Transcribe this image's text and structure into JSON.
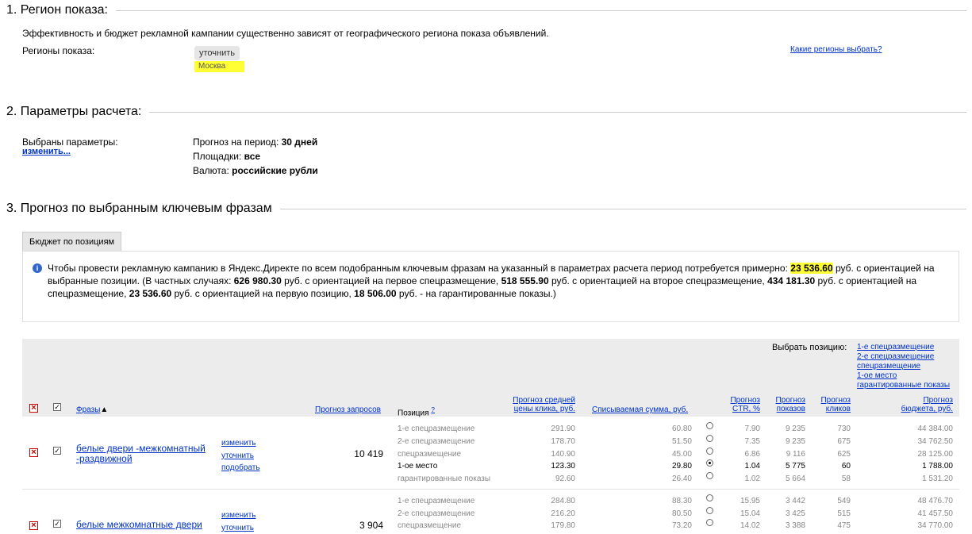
{
  "sections": {
    "s1": "1. Регион показа:",
    "s2": "2. Параметры расчета:",
    "s3": "3. Прогноз по выбранным ключевым фразам"
  },
  "region": {
    "desc": "Эффективность и бюджет рекламной кампании существенно зависят от географического региона показа объявлений.",
    "label": "Регионы показа:",
    "refine_button": "уточнить",
    "selected_region": "Москва",
    "help_link": "Какие регионы выбрать?"
  },
  "params": {
    "label": "Выбраны параметры:",
    "change_link": "изменить...",
    "period_label": "Прогноз на период:",
    "period_value": "30 дней",
    "sites_label": "Площадки:",
    "sites_value": "все",
    "currency_label": "Валюта:",
    "currency_value": "российские рубли"
  },
  "tab_label": "Бюджет по позициям",
  "info": {
    "p1": "Чтобы провести рекламную кампанию в Яндекс.Директе по всем подобранным ключевым фразам на указанный в параметрах расчета период потребуется примерно:",
    "total": "23 536.60",
    "p2": "руб. с ориентацией на выбранные позиции. (В частных случаях:",
    "v1": "626 980.30",
    "p3": "руб. с ориентацией на первое спецразмещение,",
    "v2": "518 555.90",
    "p4": "руб. с ориентацией на второе спецразмещение,",
    "v3": "434 181.30",
    "p5": "руб. с ориентацией на спецразмещение,",
    "v4": "23 536.60",
    "p6": "руб. с ориентацией на первую позицию,",
    "v5": "18 506.00",
    "p7": "руб. - на гарантированные показы.)"
  },
  "table": {
    "choose_position_label": "Выбрать позицию:",
    "position_links": [
      "1-е спецразмещение",
      "2-е спецразмещение",
      "спецразмещение",
      "1-ое место",
      "гарантированные показы"
    ],
    "headers": {
      "phrases": "Фразы",
      "sort_arrow": "▲",
      "queries": "Прогноз запросов",
      "position": "Позиция",
      "position_help": "?",
      "avg_price_1": "Прогноз средней",
      "avg_price_2": "цены клика, руб.",
      "spent": "Списываемая сумма, руб.",
      "ctr_1": "Прогноз",
      "ctr_2": "CTR, %",
      "shows_1": "Прогноз",
      "shows_2": "показов",
      "clicks_1": "Прогноз",
      "clicks_2": "кликов",
      "budget_1": "Прогноз",
      "budget_2": "бюджета, руб."
    },
    "row_links": [
      "изменить",
      "уточнить",
      "подобрать"
    ],
    "rows": [
      {
        "phrase": "белые двери -межкомнатный -раздвижной",
        "queries": "10 419",
        "positions": [
          {
            "name": "1-е спецразмещение",
            "price": "291.90",
            "spent": "60.80",
            "ctr": "7.90",
            "shows": "9 235",
            "clicks": "730",
            "budget": "44 384.00",
            "selected": false
          },
          {
            "name": "2-е спецразмещение",
            "price": "178.70",
            "spent": "51.50",
            "ctr": "7.35",
            "shows": "9 235",
            "clicks": "675",
            "budget": "34 762.50",
            "selected": false
          },
          {
            "name": "спецразмещение",
            "price": "140.90",
            "spent": "45.00",
            "ctr": "6.86",
            "shows": "9 116",
            "clicks": "625",
            "budget": "28 125.00",
            "selected": false
          },
          {
            "name": "1-ое место",
            "price": "123.30",
            "spent": "29.80",
            "ctr": "1.04",
            "shows": "5 775",
            "clicks": "60",
            "budget": "1 788.00",
            "selected": true
          },
          {
            "name": "гарантированные показы",
            "price": "92.60",
            "spent": "26.40",
            "ctr": "1.02",
            "shows": "5 664",
            "clicks": "58",
            "budget": "1 531.20",
            "selected": false
          }
        ]
      },
      {
        "phrase": "белые межкомнатные двери",
        "queries": "3 904",
        "positions": [
          {
            "name": "1-е спецразмещение",
            "price": "284.80",
            "spent": "88.30",
            "ctr": "15.95",
            "shows": "3 442",
            "clicks": "549",
            "budget": "48 476.70",
            "selected": false
          },
          {
            "name": "2-е спецразмещение",
            "price": "216.20",
            "spent": "80.50",
            "ctr": "15.04",
            "shows": "3 425",
            "clicks": "515",
            "budget": "41 457.50",
            "selected": false
          },
          {
            "name": "спецразмещение",
            "price": "179.80",
            "spent": "73.20",
            "ctr": "14.02",
            "shows": "3 388",
            "clicks": "475",
            "budget": "34 770.00",
            "selected": false
          }
        ]
      }
    ]
  }
}
